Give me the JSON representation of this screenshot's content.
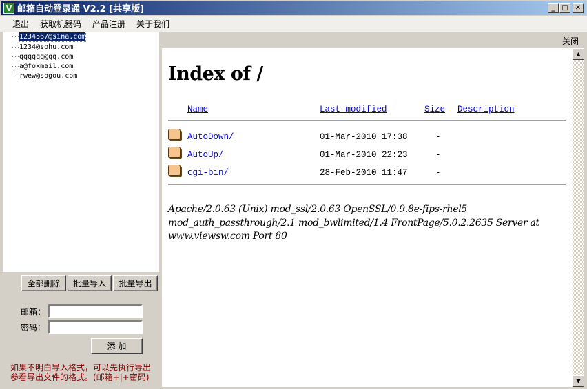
{
  "window": {
    "title": "邮箱自动登录通 V2.2 [共享版]",
    "logo": "V",
    "min": "_",
    "max": "□",
    "close": "✕"
  },
  "menu": [
    "退出",
    "获取机器码",
    "产品注册",
    "关于我们"
  ],
  "accounts": [
    "1234567@sina.com",
    "1234@sohu.com",
    "qqqqqq@qq.com",
    "a@foxmail.com",
    "rwew@sogou.com"
  ],
  "buttons": {
    "delete_all": "全部删除",
    "import": "批量导入",
    "export": "批量导出",
    "add": "添 加"
  },
  "form": {
    "email_label": "邮箱：",
    "password_label": "密码：",
    "email_value": "",
    "password_value": ""
  },
  "note": [
    "如果不明白导入格式，可以先执行导出",
    "参看导出文件的格式。(邮箱+|+密码)"
  ],
  "browser": {
    "close_label": "关闭",
    "heading": "Index of /",
    "columns": {
      "name": "Name",
      "modified": "Last modified",
      "size": "Size",
      "description": "Description"
    },
    "rows": [
      {
        "name": "AutoDown/",
        "modified": "01-Mar-2010 17:38",
        "size": "-"
      },
      {
        "name": "AutoUp/",
        "modified": "01-Mar-2010 22:23",
        "size": "-"
      },
      {
        "name": "cgi-bin/",
        "modified": "28-Feb-2010 11:47",
        "size": "-"
      }
    ],
    "address": "Apache/2.0.63 (Unix) mod_ssl/2.0.63 OpenSSL/0.9.8e-fips-rhel5 mod_auth_passthrough/2.1 mod_bwlimited/1.4 FrontPage/5.0.2.2635 Server at www.viewsw.com Port 80"
  },
  "scroll": {
    "up": "▲",
    "down": "▼"
  }
}
